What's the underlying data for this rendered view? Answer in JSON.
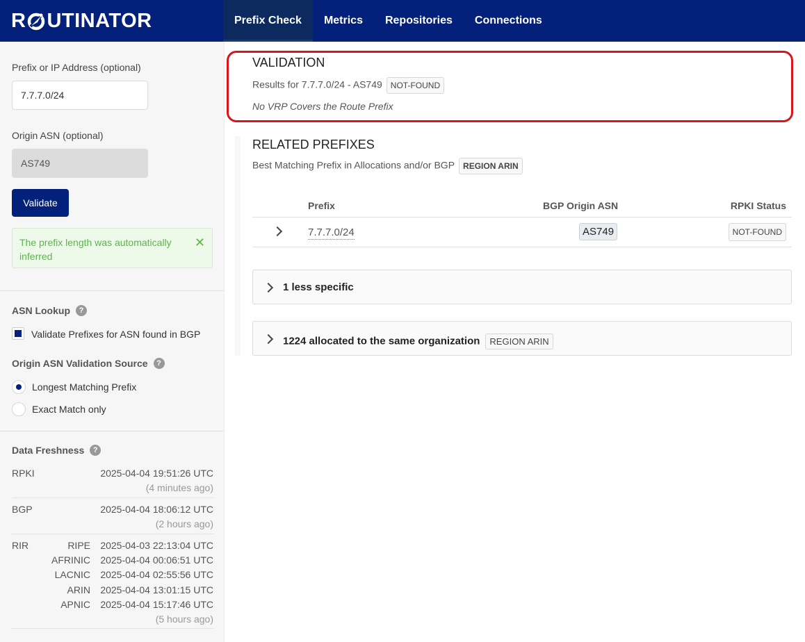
{
  "header": {
    "logo_text_1": "R",
    "logo_text_2": "UTINATOR",
    "tabs": [
      "Prefix Check",
      "Metrics",
      "Repositories",
      "Connections"
    ]
  },
  "sidebar": {
    "prefix_label": "Prefix or IP Address (optional)",
    "prefix_value": "7.7.7.0/24",
    "asn_label": "Origin ASN (optional)",
    "asn_value": "AS749",
    "validate_label": "Validate",
    "notice_text": "The prefix length was automatically inferred",
    "asn_lookup_heading": "ASN Lookup",
    "asn_lookup_option": "Validate Prefixes for ASN found in BGP",
    "source_heading": "Origin ASN Validation Source",
    "source_options": [
      "Longest Matching Prefix",
      "Exact Match only"
    ],
    "freshness_heading": "Data Freshness",
    "freshness": {
      "rpki": {
        "key": "RPKI",
        "time": "2025-04-04 19:51:26 UTC",
        "ago": "(4 minutes ago)"
      },
      "bgp": {
        "key": "BGP",
        "time": "2025-04-04 18:06:12 UTC",
        "ago": "(2 hours ago)"
      },
      "rir": {
        "key": "RIR",
        "entries": [
          {
            "name": "RIPE",
            "time": "2025-04-03 22:13:04 UTC"
          },
          {
            "name": "AFRINIC",
            "time": "2025-04-04 00:06:51 UTC"
          },
          {
            "name": "LACNIC",
            "time": "2025-04-04 02:55:56 UTC"
          },
          {
            "name": "ARIN",
            "time": "2025-04-04 13:01:15 UTC"
          },
          {
            "name": "APNIC",
            "time": "2025-04-04 15:17:46 UTC"
          }
        ],
        "ago": "(5 hours ago)"
      }
    }
  },
  "validation": {
    "title": "VALIDATION",
    "results_text": "Results for 7.7.7.0/24 - AS749",
    "status": "NOT-FOUND",
    "reason": "No VRP Covers the Route Prefix"
  },
  "related": {
    "title": "RELATED PREFIXES",
    "subtitle": "Best Matching Prefix in Allocations and/or BGP",
    "region_badge": "REGION ARIN",
    "columns": [
      "Prefix",
      "BGP Origin ASN",
      "RPKI Status"
    ],
    "row": {
      "prefix": "7.7.7.0/24",
      "asn": "AS749",
      "status": "NOT-FOUND"
    },
    "less_specific": "1 less specific",
    "same_org": "1224 allocated to the same organization",
    "same_org_badge": "REGION ARIN"
  },
  "colors": {
    "brand": "#03217a",
    "highlight": "#d8141c",
    "success": "#5bb54a"
  }
}
